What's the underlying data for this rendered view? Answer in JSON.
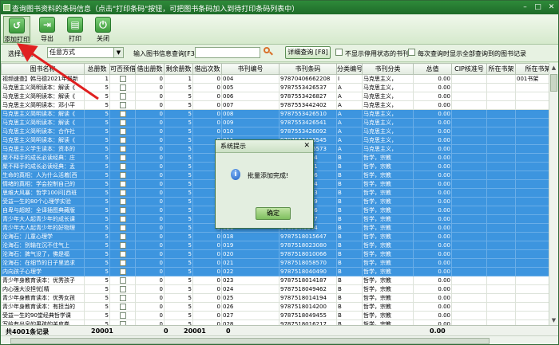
{
  "window": {
    "title": "查询图书资料的条码信息（点击\"打印条码\"按钮，可把图书条码加入到待打印条码列表中）",
    "min_glyph": "–",
    "max_glyph": "□",
    "close_glyph": "✕"
  },
  "toolbar": {
    "items": [
      {
        "label": "添加打印",
        "icon": "add-print-icon",
        "glyph": "↺"
      },
      {
        "label": "导出",
        "icon": "export-icon",
        "glyph": "⇥"
      },
      {
        "label": "打印",
        "icon": "printer-icon",
        "glyph": "▤"
      },
      {
        "label": "关闭",
        "icon": "power-icon",
        "glyph": "⏻"
      }
    ]
  },
  "filter": {
    "select_label": "选择查询",
    "select_value": "任意方式",
    "select_arrow": "▼",
    "search_label": "输入图书信息查询[F3]:",
    "search_value": "",
    "query_button": "详细查询 [F8]",
    "chk1_label": "不显示停用状态的书刊",
    "chk2_label": "每次查询时显示全部查询到的图书记录"
  },
  "columns": [
    "图书名称",
    "总册数",
    "可否预借",
    "借出册数",
    "剩余册数",
    "借出次数",
    "书刊编号",
    "书刊条码",
    "分类编号",
    "书刊分类",
    "总值",
    "CIP核准号",
    "所在书架",
    "所在书架"
  ],
  "rows": [
    {
      "sel": false,
      "name": "视频速查】韩马德2021年最新",
      "total": "1",
      "borrowed": "0",
      "remain": "1",
      "times": "0",
      "code": "004",
      "barcode": "97870406662208",
      "cls": "I",
      "category": "马克思主义，",
      "value": "0.00",
      "shelf2": "001书架"
    },
    {
      "sel": false,
      "name": "马克思主义简明读本：解读《",
      "total": "5",
      "borrowed": "0",
      "remain": "5",
      "times": "0",
      "code": "005",
      "barcode": "9787553426537",
      "cls": "A",
      "category": "马克思主义，",
      "value": "0.00",
      "shelf2": ""
    },
    {
      "sel": false,
      "name": "马克思主义简明读本：解读《",
      "total": "5",
      "borrowed": "0",
      "remain": "5",
      "times": "0",
      "code": "006",
      "barcode": "9787553426827",
      "cls": "A",
      "category": "马克思主义，",
      "value": "0.00",
      "shelf2": ""
    },
    {
      "sel": false,
      "name": "马克思主义简明读本：邓小平",
      "total": "5",
      "borrowed": "0",
      "remain": "5",
      "times": "0",
      "code": "007",
      "barcode": "9787553442402",
      "cls": "A",
      "category": "马克思主义，",
      "value": "0.00",
      "shelf2": ""
    },
    {
      "sel": true,
      "name": "马克思主义简明读本：解读《",
      "total": "5",
      "borrowed": "0",
      "remain": "5",
      "times": "0",
      "code": "008",
      "barcode": "9787553426510",
      "cls": "A",
      "category": "马克思主义，",
      "value": "0.00",
      "shelf2": ""
    },
    {
      "sel": true,
      "name": "马克思主义简明读本：解读《",
      "total": "5",
      "borrowed": "0",
      "remain": "5",
      "times": "0",
      "code": "009",
      "barcode": "9787553426541",
      "cls": "A",
      "category": "马克思主义，",
      "value": "0.00",
      "shelf2": ""
    },
    {
      "sel": true,
      "name": "马克思主义简明读本：合作社",
      "total": "5",
      "borrowed": "0",
      "remain": "5",
      "times": "0",
      "code": "010",
      "barcode": "9787553426092",
      "cls": "A",
      "category": "马克思主义，",
      "value": "0.00",
      "shelf2": ""
    },
    {
      "sel": true,
      "name": "马克思主义简明读本：解读《",
      "total": "5",
      "borrowed": "0",
      "remain": "5",
      "times": "0",
      "code": "011",
      "barcode": "9787553426545",
      "cls": "A",
      "category": "马克思主义，",
      "value": "0.00",
      "shelf2": ""
    },
    {
      "sel": true,
      "name": "马克思主义学生读本：资本的",
      "total": "5",
      "borrowed": "0",
      "remain": "5",
      "times": "0",
      "code": "012",
      "barcode": "9787553426573",
      "cls": "A",
      "category": "马克思主义，",
      "value": "0.00",
      "shelf2": ""
    },
    {
      "sel": true,
      "name": "聚不释手的成长必读经典：庄",
      "total": "5",
      "borrowed": "0",
      "remain": "5",
      "times": "0",
      "code": "013",
      "barcode": "97875...2144",
      "cls": "B",
      "category": "哲学，宗教",
      "value": "0.00",
      "shelf2": ""
    },
    {
      "sel": true,
      "name": "聚不释手的成长必读经典：孟",
      "total": "5",
      "borrowed": "0",
      "remain": "5",
      "times": "0",
      "code": "014",
      "barcode": "97875...2151",
      "cls": "B",
      "category": "哲学，宗教",
      "value": "0.00",
      "shelf2": ""
    },
    {
      "sel": true,
      "name": "生命的真相：人为什么活着[西",
      "total": "5",
      "borrowed": "0",
      "remain": "5",
      "times": "0",
      "code": "015",
      "barcode": "97875...8226",
      "cls": "B",
      "category": "哲学，宗教",
      "value": "0.00",
      "shelf2": ""
    },
    {
      "sel": true,
      "name": "情绪的真相：学会控制自己的",
      "total": "5",
      "borrowed": "0",
      "remain": "5",
      "times": "0",
      "code": "016",
      "barcode": "97875...9834",
      "cls": "B",
      "category": "哲学，宗教",
      "value": "0.00",
      "shelf2": ""
    },
    {
      "sel": true,
      "name": "思维大风暴：哲学100问[西班",
      "total": "5",
      "borrowed": "0",
      "remain": "5",
      "times": "0",
      "code": "017",
      "barcode": "97875...1203",
      "cls": "B",
      "category": "哲学，宗教",
      "value": "0.00",
      "shelf2": ""
    },
    {
      "sel": true,
      "name": "受益一生的80个心理学实验",
      "total": "5",
      "borrowed": "0",
      "remain": "5",
      "times": "0",
      "code": "018",
      "barcode": "97875...5489",
      "cls": "B",
      "category": "哲学，宗教",
      "value": "0.00",
      "shelf2": ""
    },
    {
      "sel": true,
      "name": "自卑与超越：全译插图典藏版",
      "total": "5",
      "borrowed": "0",
      "remain": "5",
      "times": "0",
      "code": "019",
      "barcode": "97875...0026",
      "cls": "B",
      "category": "哲学，宗教",
      "value": "0.00",
      "shelf2": ""
    },
    {
      "sel": true,
      "name": "青少年大人起青少年的成长课",
      "total": "5",
      "borrowed": "0",
      "remain": "5",
      "times": "0",
      "code": "020",
      "barcode": "97875...9537",
      "cls": "B",
      "category": "哲学，宗教",
      "value": "0.00",
      "shelf2": ""
    },
    {
      "sel": true,
      "name": "青少年大人起青少年的好物理",
      "total": "5",
      "borrowed": "0",
      "remain": "5",
      "times": "0",
      "code": "021",
      "barcode": "97875...9544",
      "cls": "B",
      "category": "哲学，宗教",
      "value": "0.00",
      "shelf2": ""
    },
    {
      "sel": true,
      "name": "沦海石：儿童心理学",
      "total": "5",
      "borrowed": "0",
      "remain": "5",
      "times": "0",
      "code": "018",
      "barcode": "9787518015647",
      "cls": "B",
      "category": "哲学，宗教",
      "value": "0.00",
      "shelf2": ""
    },
    {
      "sel": true,
      "name": "沦海石：别输在沉不住气上",
      "total": "5",
      "borrowed": "0",
      "remain": "5",
      "times": "0",
      "code": "019",
      "barcode": "9787518023080",
      "cls": "B",
      "category": "哲学，宗教",
      "value": "0.00",
      "shelf2": ""
    },
    {
      "sel": true,
      "name": "沦海石：脾气没了，佛是福",
      "total": "5",
      "borrowed": "0",
      "remain": "5",
      "times": "0",
      "code": "020",
      "barcode": "9787518010066",
      "cls": "B",
      "category": "哲学，宗教",
      "value": "0.00",
      "shelf2": ""
    },
    {
      "sel": true,
      "name": "沦海石：在细节的日子里追求",
      "total": "5",
      "borrowed": "0",
      "remain": "5",
      "times": "0",
      "code": "021",
      "barcode": "9787518058570",
      "cls": "B",
      "category": "哲学，宗教",
      "value": "0.00",
      "shelf2": ""
    },
    {
      "sel": true,
      "name": "内向孩子心理学",
      "total": "5",
      "borrowed": "0",
      "remain": "5",
      "times": "0",
      "code": "022",
      "barcode": "9787518040490",
      "cls": "B",
      "category": "哲学，宗教",
      "value": "0.00",
      "shelf2": ""
    },
    {
      "sel": false,
      "name": "青少年身教育读本：优秀孩子",
      "total": "5",
      "borrowed": "0",
      "remain": "5",
      "times": "0",
      "code": "023",
      "barcode": "9787518014187",
      "cls": "B",
      "category": "哲学，宗教",
      "value": "0.00",
      "shelf2": ""
    },
    {
      "sel": false,
      "name": "内心强大没担忧[精",
      "total": "5",
      "borrowed": "0",
      "remain": "5",
      "times": "0",
      "code": "024",
      "barcode": "9787518049462",
      "cls": "B",
      "category": "哲学，宗教",
      "value": "0.00",
      "shelf2": ""
    },
    {
      "sel": false,
      "name": "青少年身教育读本：优秀女孩",
      "total": "5",
      "borrowed": "0",
      "remain": "5",
      "times": "0",
      "code": "025",
      "barcode": "9787518014194",
      "cls": "B",
      "category": "哲学，宗教",
      "value": "0.00",
      "shelf2": ""
    },
    {
      "sel": false,
      "name": "青少年身教育读本：有担当的",
      "total": "5",
      "borrowed": "0",
      "remain": "5",
      "times": "0",
      "code": "026",
      "barcode": "9787518014200",
      "cls": "B",
      "category": "哲学，宗教",
      "value": "0.00",
      "shelf2": ""
    },
    {
      "sel": false,
      "name": "受益一生的90堂经典哲学课",
      "total": "5",
      "borrowed": "0",
      "remain": "5",
      "times": "0",
      "code": "027",
      "barcode": "9787518049455",
      "cls": "B",
      "category": "哲学，宗教",
      "value": "0.00",
      "shelf2": ""
    },
    {
      "sel": false,
      "name": "写给有出息的男孩的羊皮卷",
      "total": "5",
      "borrowed": "0",
      "remain": "5",
      "times": "0",
      "code": "028",
      "barcode": "9787518016217",
      "cls": "B",
      "category": "哲学，宗教",
      "value": "0.00",
      "shelf2": ""
    },
    {
      "sel": false,
      "name": "北大也：一个好处二看人上：",
      "total": "5",
      "borrowed": "0",
      "remain": "5",
      "times": "0",
      "code": "029",
      "barcode": "9787518016393",
      "cls": "B",
      "category": "哲学，宗教",
      "value": "0.00",
      "shelf2": ""
    }
  ],
  "footer": {
    "count": "共4001条记录",
    "total": "20001",
    "borrowed": "0",
    "remain": "20001",
    "times": "0",
    "value": "0.00"
  },
  "dialog": {
    "title": "系统提示",
    "close_glyph": "✕",
    "info_glyph": "i",
    "message": "批量添加完成!",
    "ok": "确定"
  },
  "colors": {
    "selection": "#3d95df",
    "annotation_arrow": "#e02020"
  }
}
